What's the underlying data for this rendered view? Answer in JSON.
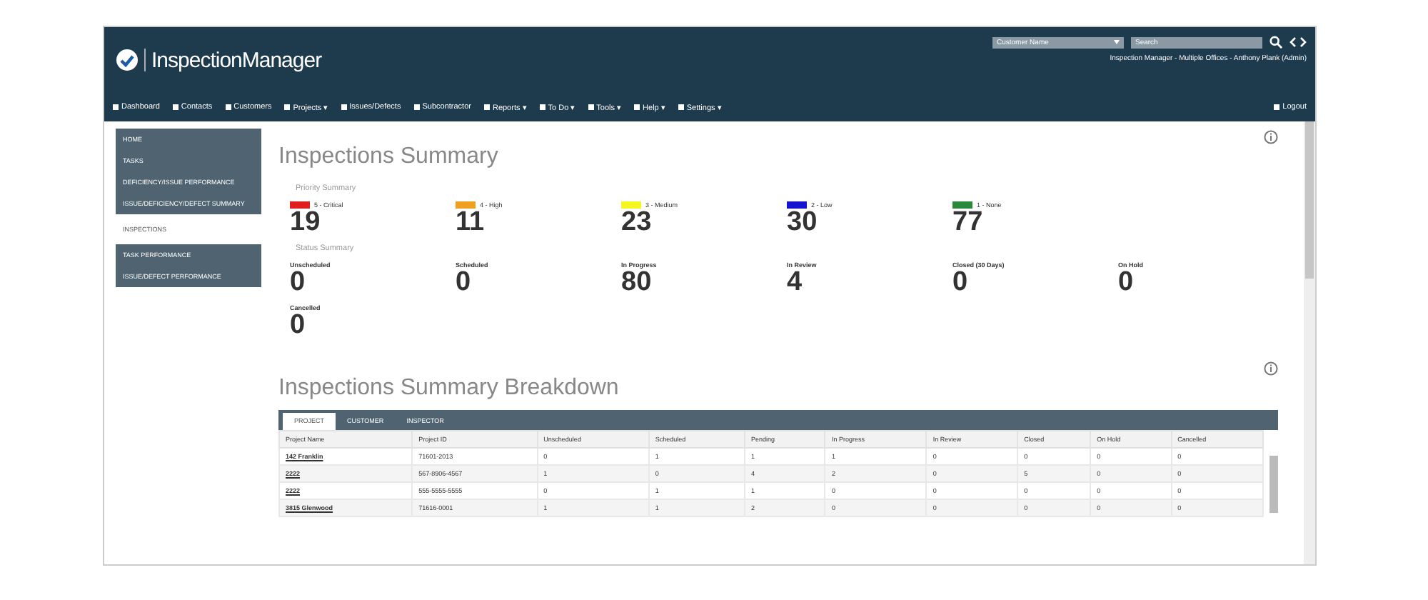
{
  "header": {
    "logo_text": "InspectionManager",
    "customer_select": "Customer Name",
    "search": {
      "placeholder": "Search"
    },
    "user_line": "Inspection Manager - Multiple Offices - Anthony Plank (Admin)"
  },
  "nav": [
    {
      "label": "Dashboard"
    },
    {
      "label": "Contacts"
    },
    {
      "label": "Customers"
    },
    {
      "label": "Projects ▾"
    },
    {
      "label": "Issues/Defects"
    },
    {
      "label": "Subcontractor"
    },
    {
      "label": "Reports ▾"
    },
    {
      "label": "To Do ▾"
    },
    {
      "label": "Tools ▾"
    },
    {
      "label": "Help ▾"
    },
    {
      "label": "Settings ▾"
    }
  ],
  "logout": "Logout",
  "sidebar": {
    "items": [
      {
        "label": "HOME",
        "selected": false
      },
      {
        "label": "TASKS",
        "selected": false
      },
      {
        "label": "DEFICIENCY/ISSUE PERFORMANCE",
        "selected": false
      },
      {
        "label": "ISSUE/DEFICIENCY/DEFECT SUMMARY",
        "selected": false
      },
      {
        "label": "INSPECTIONS",
        "selected": true
      },
      {
        "label": "TASK PERFORMANCE",
        "selected": false
      },
      {
        "label": "ISSUE/DEFECT PERFORMANCE",
        "selected": false
      }
    ]
  },
  "summary": {
    "title": "Inspections Summary",
    "priority_label": "Priority Summary",
    "priorities": [
      {
        "label": "5 - Critical",
        "value": "19",
        "color": "#e02020"
      },
      {
        "label": "4 - High",
        "value": "11",
        "color": "#f0a020"
      },
      {
        "label": "3 - Medium",
        "value": "23",
        "color": "#f5f520"
      },
      {
        "label": "2 - Low",
        "value": "30",
        "color": "#1515d0"
      },
      {
        "label": "1 - None",
        "value": "77",
        "color": "#2a8a3a"
      }
    ],
    "status_label": "Status Summary",
    "statuses": [
      {
        "label": "Unscheduled",
        "value": "0"
      },
      {
        "label": "Scheduled",
        "value": "0"
      },
      {
        "label": "In Progress",
        "value": "80"
      },
      {
        "label": "In Review",
        "value": "4"
      },
      {
        "label": "Closed (30 Days)",
        "value": "0"
      },
      {
        "label": "On Hold",
        "value": "0"
      },
      {
        "label": "Cancelled",
        "value": "0"
      }
    ]
  },
  "breakdown": {
    "title": "Inspections Summary Breakdown",
    "tabs": [
      {
        "label": "PROJECT",
        "selected": true
      },
      {
        "label": "CUSTOMER",
        "selected": false
      },
      {
        "label": "INSPECTOR",
        "selected": false
      }
    ],
    "columns": [
      "Project Name",
      "Project ID",
      "Unscheduled",
      "Scheduled",
      "Pending",
      "In Progress",
      "In Review",
      "Closed",
      "On Hold",
      "Cancelled"
    ],
    "rows": [
      [
        "142 Franklin",
        "71601-2013",
        "0",
        "1",
        "1",
        "1",
        "0",
        "0",
        "0",
        "0"
      ],
      [
        "2222",
        "567-8906-4567",
        "1",
        "0",
        "4",
        "2",
        "0",
        "5",
        "0",
        "0"
      ],
      [
        "2222",
        "555-5555-5555",
        "0",
        "1",
        "1",
        "0",
        "0",
        "0",
        "0",
        "0"
      ],
      [
        "3815 Glenwood",
        "71616-0001",
        "1",
        "1",
        "2",
        "0",
        "0",
        "0",
        "0",
        "0"
      ]
    ]
  }
}
